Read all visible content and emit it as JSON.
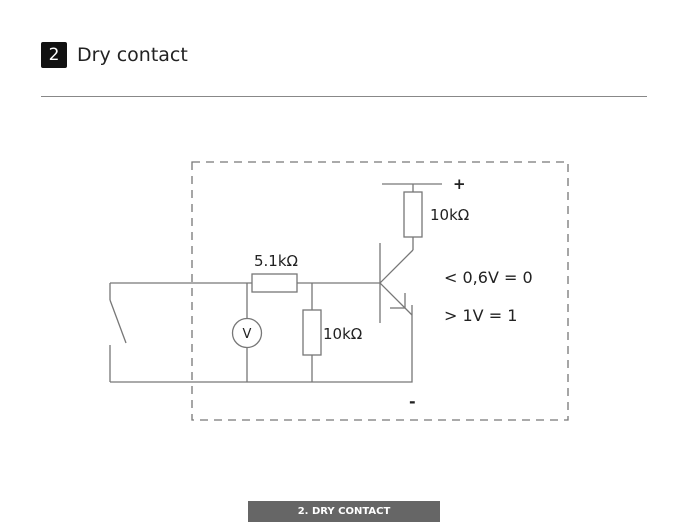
{
  "header": {
    "number": "2",
    "title": "Dry contact"
  },
  "diagram": {
    "resistor_pullup": "10kΩ",
    "resistor_series": "5.1kΩ",
    "resistor_shunt": "10kΩ",
    "voltmeter": "V",
    "plus": "+",
    "minus": "-",
    "logic_low": "< 0,6V = 0",
    "logic_high": "> 1V = 1"
  },
  "footer": {
    "label": "2. DRY CONTACT"
  }
}
